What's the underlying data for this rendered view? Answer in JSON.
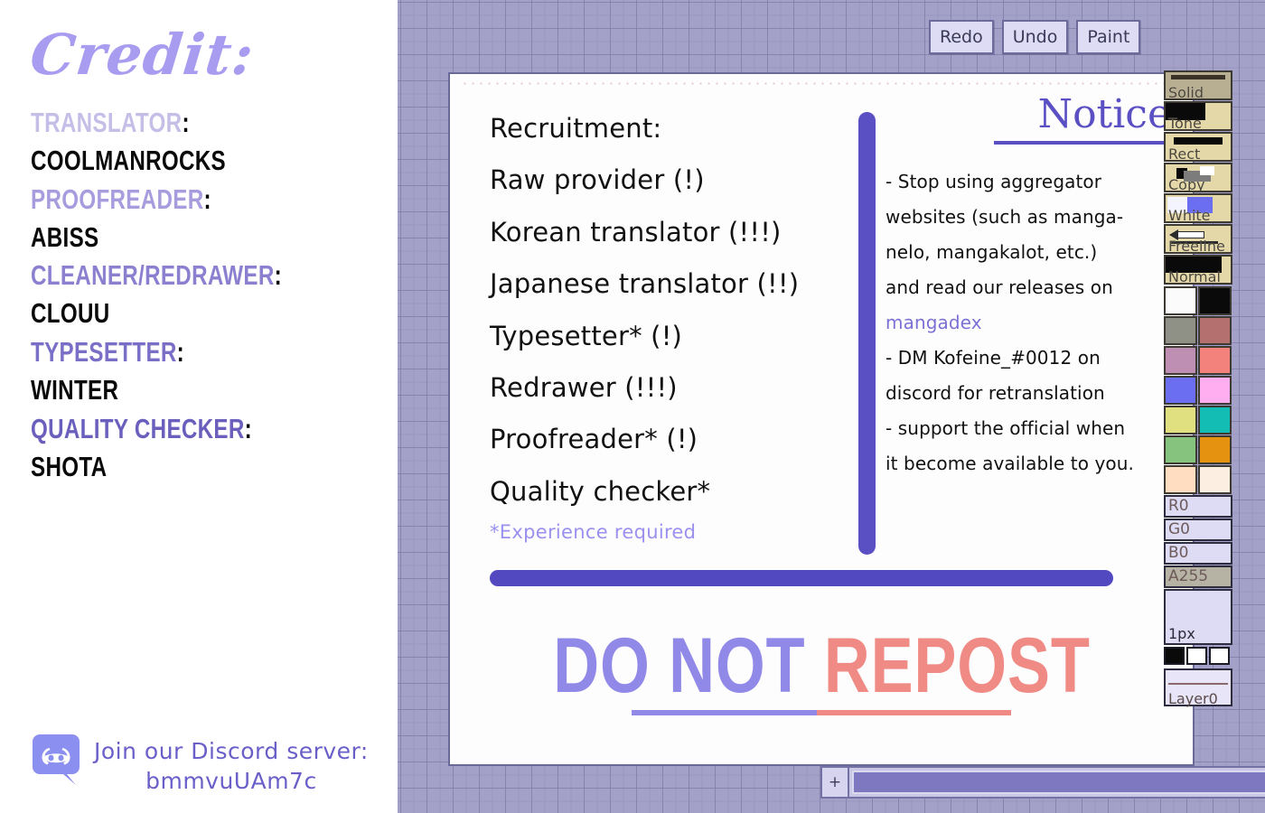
{
  "credit": {
    "title": "Credit:",
    "roles": [
      {
        "label": "TRANSLATOR",
        "name": "COOLMANROCKS",
        "color": "#c5bfe8"
      },
      {
        "label": "PROOFREADER",
        "name": "ABISS",
        "color": "#a79dde"
      },
      {
        "label": "CLEANER/REDRAWER",
        "name": "CLOUU",
        "color": "#8b80d0"
      },
      {
        "label": "TYPESETTER",
        "name": "WINTER",
        "color": "#7a6fc6"
      },
      {
        "label": "QUALITY CHECKER",
        "name": "SHOTA",
        "color": "#6a5fbc"
      }
    ],
    "discord": {
      "icon": "discord-logo-icon",
      "join_text": "Join our Discord server:",
      "invite_code": "bmmvuUAm7c"
    }
  },
  "toolbar": {
    "buttons": [
      {
        "label": "Redo",
        "name": "redo-button"
      },
      {
        "label": "Undo",
        "name": "undo-button"
      },
      {
        "label": "Paint",
        "name": "paint-button"
      }
    ]
  },
  "canvas": {
    "recruitment": {
      "heading": "Recruitment:",
      "items": [
        "Raw provider (!)",
        "Korean translator (!!!)",
        "Japanese translator (!!)",
        "Typesetter* (!)",
        "Redrawer (!!!)",
        "Proofreader* (!)",
        "Quality checker*"
      ],
      "footnote": "*Experience required"
    },
    "notice": {
      "title": "Notice",
      "lines": [
        {
          "text": "- Stop using aggregator",
          "link": false
        },
        {
          "text": "websites (such as manga-",
          "link": false
        },
        {
          "text": "nelo, mangakalot, etc.)",
          "link": false
        },
        {
          "text": "and read our releases on",
          "link": false
        },
        {
          "text": "mangadex",
          "link": true
        },
        {
          "text": "- DM Kofeine_#0012 on",
          "link": false
        },
        {
          "text": "discord for retranslation",
          "link": false
        },
        {
          "text": "- support the official when",
          "link": false
        },
        {
          "text": "it become available to you.",
          "link": false
        }
      ]
    },
    "watermark": {
      "part_a": "DO NOT",
      "part_b": "REPOST",
      "color_a": "#9189e8",
      "color_b": "#f08a84"
    }
  },
  "scrollbars": {
    "h_decrease_label": "+",
    "h_increase_label": "-"
  },
  "palette": {
    "tools": [
      {
        "label": "Solid",
        "name": "tool-solid",
        "active": true
      },
      {
        "label": "Tone",
        "name": "tool-tone",
        "active": false
      },
      {
        "label": "Rect",
        "name": "tool-rect",
        "active": false
      },
      {
        "label": "Copy",
        "name": "tool-copy",
        "active": false
      },
      {
        "label": "White",
        "name": "tool-white",
        "active": false
      },
      {
        "label": "Freeline",
        "name": "tool-freeline",
        "active": false
      },
      {
        "label": "Normal",
        "name": "tool-normal",
        "active": false
      }
    ],
    "swatches": [
      "#fbfbfb",
      "#0a0a0a",
      "#8f9186",
      "#b4706f",
      "#bf8fb3",
      "#f4827c",
      "#6b6ef0",
      "#ffaff0",
      "#e0e080",
      "#13bdb3",
      "#85c37f",
      "#e59210",
      "#ffddc0",
      "#fdeee2"
    ],
    "channels": [
      {
        "label": "R0",
        "name": "channel-r",
        "selected": false
      },
      {
        "label": "G0",
        "name": "channel-g",
        "selected": false
      },
      {
        "label": "B0",
        "name": "channel-b",
        "selected": false
      },
      {
        "label": "A255",
        "name": "channel-a",
        "selected": true
      }
    ],
    "brush_size": "1px",
    "mini_swatches": [
      "#0a0a0a",
      "#ffffff",
      "#ffffff"
    ],
    "layer_label": "Layer0"
  }
}
